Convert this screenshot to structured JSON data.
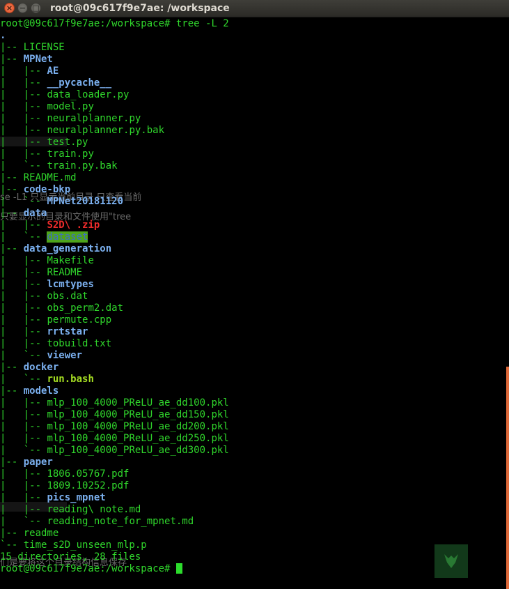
{
  "window": {
    "title": "root@09c617f9e7ae: /workspace",
    "close_glyph": "×",
    "minimize_glyph": "−",
    "maximize_glyph": "□"
  },
  "colors": {
    "background": "#000000",
    "text_green": "#30d72c",
    "directory_blue": "#7bb0ef",
    "executable_lime": "#a4dc22",
    "archive_red": "#ec2b2b",
    "highlight_bg": "#4ea41b"
  },
  "background_ghosts": {
    "line1": "se -L1 只显示当前目录 只查看当前",
    "line2": "只要显示的目录和文件使用\"tree",
    "line3": "们是要将这个目录结构信息保存"
  },
  "terminal": {
    "prompt": "root@09c617f9e7ae:/workspace#",
    "command": " tree -L 2",
    "tree": {
      "l01": ".",
      "l02": {
        "p": "|-- ",
        "n": "LICENSE"
      },
      "l03": {
        "p": "|-- ",
        "n": "MPNet"
      },
      "l04": {
        "p": "|   |-- ",
        "n": "AE"
      },
      "l05": {
        "p": "|   |-- ",
        "n": "__pycache__"
      },
      "l06": {
        "p": "|   |-- ",
        "n": "data_loader.py"
      },
      "l07": {
        "p": "|   |-- ",
        "n": "model.py"
      },
      "l08": {
        "p": "|   |-- ",
        "n": "neuralplanner.py"
      },
      "l09": {
        "p": "|   |-- ",
        "n": "neuralplanner.py.bak"
      },
      "l10": {
        "p": "|   |-- ",
        "n": "test.py"
      },
      "l11": {
        "p": "|   |-- ",
        "n": "train.py"
      },
      "l12": {
        "p": "|   `-- ",
        "n": "train.py.bak"
      },
      "l13": {
        "p": "|-- ",
        "n": "README.md"
      },
      "l14": {
        "p": "|-- ",
        "n": "code-bkp"
      },
      "l15": {
        "p": "|   `-- ",
        "n": "MPNet20181120"
      },
      "l16": {
        "p": "|-- ",
        "n": "data"
      },
      "l17": {
        "p": "|   |-- ",
        "n": "S2D\\ .zip"
      },
      "l18": {
        "p": "|   `-- ",
        "n": "dataset"
      },
      "l19": {
        "p": "|-- ",
        "n": "data_generation"
      },
      "l20": {
        "p": "|   |-- ",
        "n": "Makefile"
      },
      "l21": {
        "p": "|   |-- ",
        "n": "README"
      },
      "l22": {
        "p": "|   |-- ",
        "n": "lcmtypes"
      },
      "l23": {
        "p": "|   |-- ",
        "n": "obs.dat"
      },
      "l24": {
        "p": "|   |-- ",
        "n": "obs_perm2.dat"
      },
      "l25": {
        "p": "|   |-- ",
        "n": "permute.cpp"
      },
      "l26": {
        "p": "|   |-- ",
        "n": "rrtstar"
      },
      "l27": {
        "p": "|   |-- ",
        "n": "tobuild.txt"
      },
      "l28": {
        "p": "|   `-- ",
        "n": "viewer"
      },
      "l29": {
        "p": "|-- ",
        "n": "docker"
      },
      "l30": {
        "p": "|   `-- ",
        "n": "run.bash"
      },
      "l31": {
        "p": "|-- ",
        "n": "models"
      },
      "l32": {
        "p": "|   |-- ",
        "n": "mlp_100_4000_PReLU_ae_dd100.pkl"
      },
      "l33": {
        "p": "|   |-- ",
        "n": "mlp_100_4000_PReLU_ae_dd150.pkl"
      },
      "l34": {
        "p": "|   |-- ",
        "n": "mlp_100_4000_PReLU_ae_dd200.pkl"
      },
      "l35": {
        "p": "|   |-- ",
        "n": "mlp_100_4000_PReLU_ae_dd250.pkl"
      },
      "l36": {
        "p": "|   `-- ",
        "n": "mlp_100_4000_PReLU_ae_dd300.pkl"
      },
      "l37": {
        "p": "|-- ",
        "n": "paper"
      },
      "l38": {
        "p": "|   |-- ",
        "n": "1806.05767.pdf"
      },
      "l39": {
        "p": "|   |-- ",
        "n": "1809.10252.pdf"
      },
      "l40": {
        "p": "|   |-- ",
        "n": "pics_mpnet"
      },
      "l41": {
        "p": "|   |-- ",
        "n": "reading\\ note.md"
      },
      "l42": {
        "p": "|   `-- ",
        "n": "reading_note_for_mpnet.md"
      },
      "l43": {
        "p": "|-- ",
        "n": "readme"
      },
      "l44": {
        "p": "`-- ",
        "n": "time_s2D_unseen_mlp.p"
      }
    },
    "summary": "15 directories, 28 files"
  }
}
